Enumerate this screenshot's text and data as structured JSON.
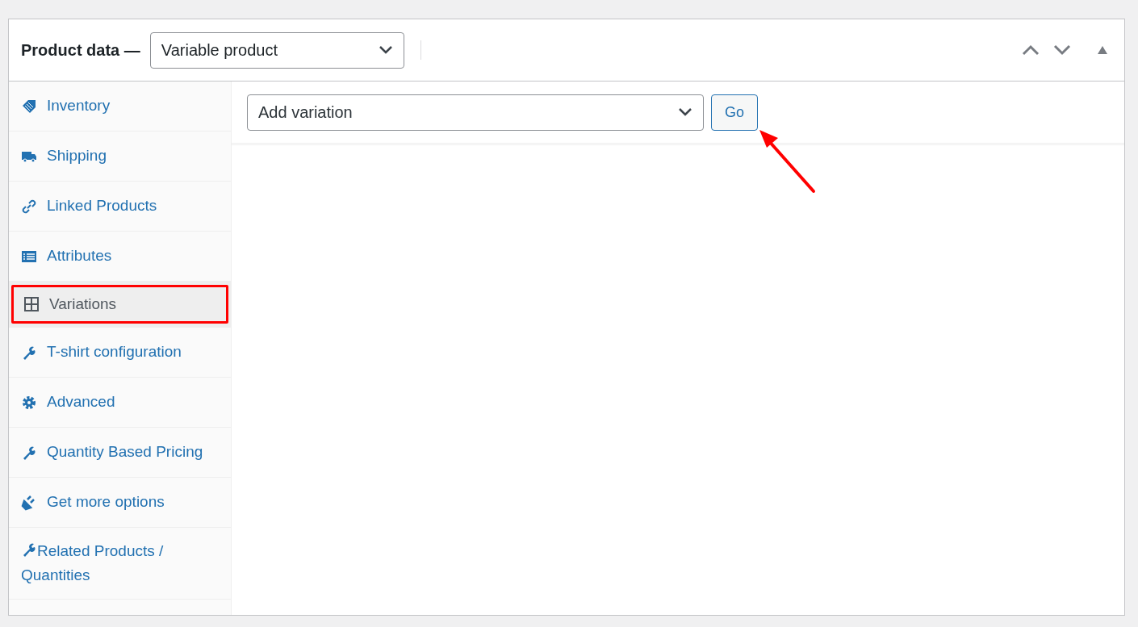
{
  "header": {
    "title": "Product data —",
    "product_type": "Variable product"
  },
  "sidebar": {
    "items": [
      {
        "label": "Inventory",
        "selected": false
      },
      {
        "label": "Shipping",
        "selected": false
      },
      {
        "label": "Linked Products",
        "selected": false
      },
      {
        "label": "Attributes",
        "selected": false
      },
      {
        "label": "Variations",
        "selected": true
      },
      {
        "label": "T-shirt configuration",
        "selected": false
      },
      {
        "label": "Advanced",
        "selected": false
      },
      {
        "label": "Quantity Based Pricing",
        "selected": false
      },
      {
        "label": "Get more options",
        "selected": false
      },
      {
        "label": "Related Products / Quantities",
        "selected": false
      }
    ]
  },
  "variations": {
    "action": "Add variation",
    "button": "Go"
  }
}
